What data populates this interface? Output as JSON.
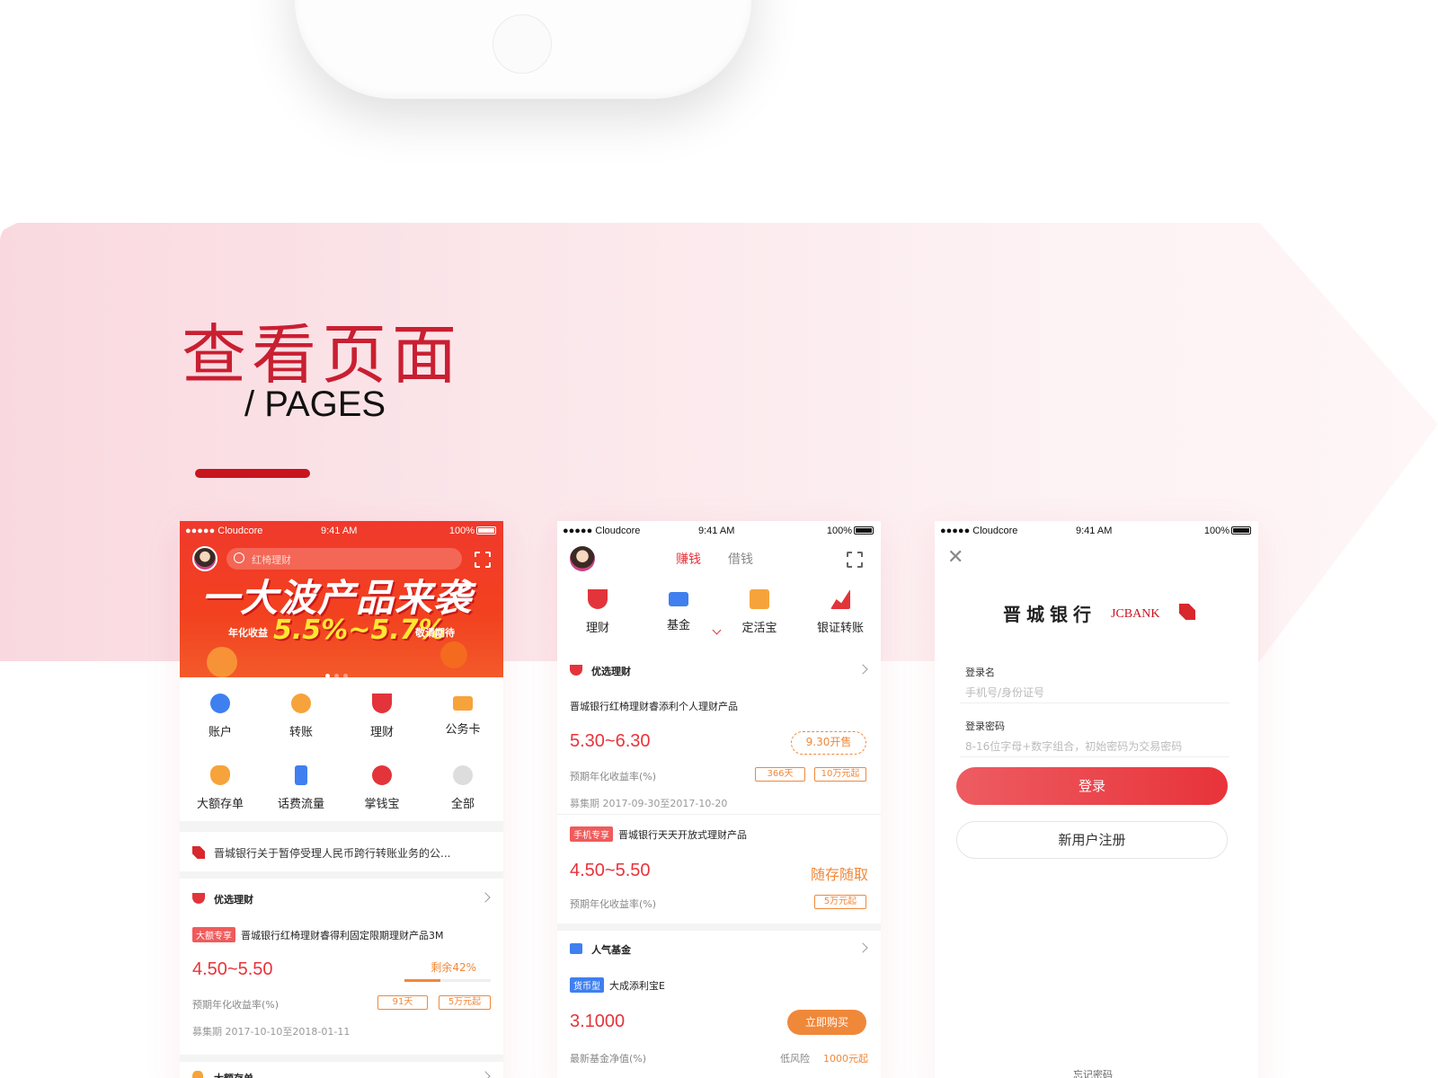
{
  "title_cn": "查看页面",
  "title_en": "/ PAGES",
  "status": {
    "carrier": "●●●●● Cloudcore",
    "time": "9:41 AM",
    "battery": "100%"
  },
  "colors": {
    "accent": "#e8333a",
    "brand_red": "#c8141f",
    "orange": "#f0883a"
  },
  "phone1": {
    "search_placeholder": "红椅理财",
    "banner_headline": "一大波产品来袭",
    "banner_rate_label": "年化收益",
    "banner_rate": "5.5%~5.7%",
    "banner_rate_tail": "敬请期待",
    "grid": [
      "账户",
      "转账",
      "理财",
      "公务卡",
      "大额存单",
      "话费流量",
      "掌钱宝",
      "全部"
    ],
    "notice": "晋城银行关于暂停受理人民币跨行转账业务的公...",
    "section_title": "优选理财",
    "product_tag": "大额专享",
    "product_name": "晋城银行红椅理财睿得利固定限期理财产品3M",
    "product_rate": "4.50~5.50",
    "product_remaining": "剩余42%",
    "remaining_fraction": 0.42,
    "product_rate_label": "预期年化收益率(%)",
    "pill_days": "91天",
    "pill_min": "5万元起",
    "raise_period": "募集期   2017-10-10至2018-01-11",
    "section2_title": "大额存单"
  },
  "phone2": {
    "tab_active": "赚钱",
    "tab_inactive": "借钱",
    "icons": [
      "理财",
      "基金",
      "定活宝",
      "银证转账"
    ],
    "section_title": "优选理财",
    "product1_name": "晋城银行红椅理财睿添利个人理财产品",
    "product1_rate": "5.30~6.30",
    "product1_badge": "9.30开售",
    "product1_rate_label": "预期年化收益率(%)",
    "product1_pill1": "366天",
    "product1_pill2": "10万元起",
    "product1_period": "募集期   2017-09-30至2017-10-20",
    "product2_tag": "手机专享",
    "product2_name": "晋城银行天天开放式理财产品",
    "product2_rate": "4.50~5.50",
    "product2_right": "随存随取",
    "product2_rate_label": "预期年化收益率(%)",
    "product2_pill": "5万元起",
    "fund_section": "人气基金",
    "fund_tag": "货币型",
    "fund_name": "大成添利宝E",
    "fund_value": "3.1000",
    "fund_buy": "立即购买",
    "fund_value_label": "最新基金净值(%)",
    "fund_risk": "低风险",
    "fund_min": "1000元起"
  },
  "phone3": {
    "close": "✕",
    "logo_cn": "晋城银行",
    "logo_en": "JCBANK",
    "username_label": "登录名",
    "username_placeholder": "手机号/身份证号",
    "password_label": "登录密码",
    "password_placeholder": "8-16位字母+数字组合，初始密码为交易密码",
    "login_button": "登录",
    "register_button": "新用户注册",
    "forgot": "忘记密码"
  }
}
